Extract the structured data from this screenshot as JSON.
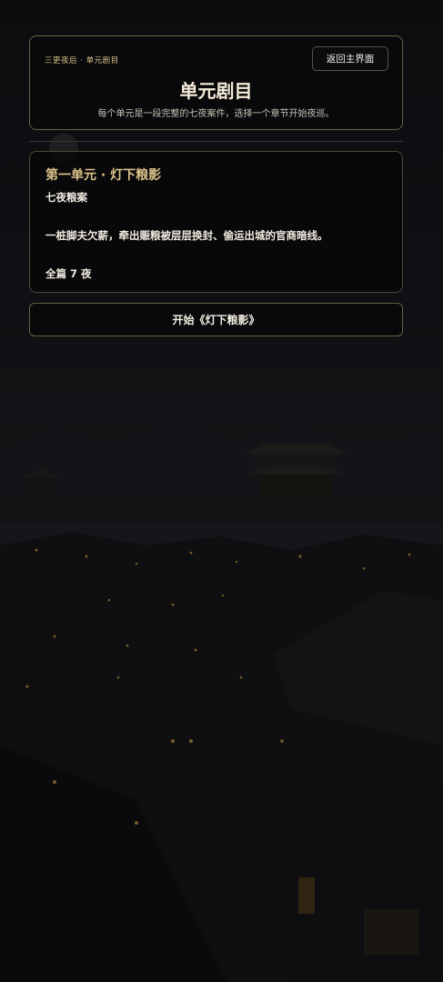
{
  "header": {
    "breadcrumb": "三更夜后 · 单元剧目",
    "back_label": "返回主界面",
    "title": "单元剧目",
    "subtitle": "每个单元是一段完整的七夜案件，选择一个章节开始夜巡。"
  },
  "units": [
    {
      "title": "第一单元 · 灯下粮影",
      "case_name": "七夜粮案",
      "description": "一桩脚夫欠薪，牵出赈粮被层层换封、偷运出城的官商暗线。",
      "count": "全篇 7 夜"
    }
  ],
  "actions": {
    "start_label": "开始《灯下粮影》"
  },
  "colors": {
    "accent_gold": "#dcc28a",
    "border_gold": "#6b5f43",
    "background": "#0b0b0e"
  }
}
